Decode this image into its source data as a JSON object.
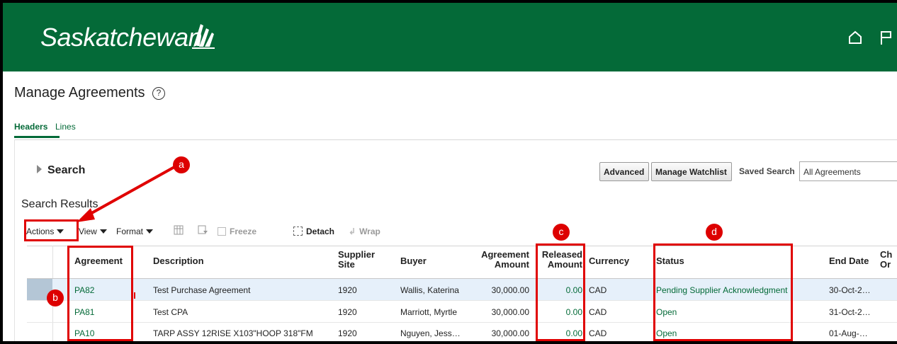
{
  "brand": {
    "name": "Saskatchewan"
  },
  "page": {
    "title": "Manage Agreements",
    "help_glyph": "?"
  },
  "tabs": [
    {
      "label": "Headers"
    },
    {
      "label": "Lines"
    }
  ],
  "search": {
    "toggle_label": "Search",
    "advanced_label": "Advanced",
    "watchlist_label": "Manage Watchlist",
    "saved_search_label": "Saved Search",
    "saved_search_value": "All Agreements"
  },
  "results": {
    "title": "Search Results",
    "toolbar": {
      "actions": "Actions",
      "view": "View",
      "format": "Format",
      "freeze": "Freeze",
      "detach": "Detach",
      "wrap": "Wrap"
    },
    "columns": {
      "agreement": "Agreement",
      "description": "Description",
      "supplier_site_1": "Supplier",
      "supplier_site_2": "Site",
      "buyer": "Buyer",
      "agreement_amount_1": "Agreement",
      "agreement_amount_2": "Amount",
      "released_amount_1": "Released",
      "released_amount_2": "Amount",
      "currency": "Currency",
      "status": "Status",
      "end_date": "End Date",
      "change_order_1": "Ch",
      "change_order_2": "Or"
    },
    "rows": [
      {
        "agreement": "PA82",
        "description": "Test Purchase Agreement",
        "site": "1920",
        "buyer": "Wallis, Katerina",
        "amount": "30,000.00",
        "released": "0.00",
        "currency": "CAD",
        "status": "Pending Supplier Acknowledgment",
        "end_date": "30-Oct-2…"
      },
      {
        "agreement": "PA81",
        "description": "Test CPA",
        "site": "1920",
        "buyer": "Marriott, Myrtle",
        "amount": "30,000.00",
        "released": "0.00",
        "currency": "CAD",
        "status": "Open",
        "end_date": "31-Oct-2…"
      },
      {
        "agreement": "PA10",
        "description": "TARP ASSY 12RISE X103\"HOOP 318\"FM",
        "site": "1920",
        "buyer": "Nguyen, Jess…",
        "amount": "30,000.00",
        "released": "0.00",
        "currency": "CAD",
        "status": "Open",
        "end_date": "01-Aug-…"
      }
    ]
  },
  "annotations": {
    "a": "a",
    "b": "b",
    "c": "c",
    "d": "d"
  },
  "colors": {
    "brand_green": "#046a38",
    "callout_red": "#dd0000",
    "selected_row": "#e6f0fa"
  },
  "icons": [
    "home-icon",
    "flag-icon",
    "help-icon",
    "freeze-icon",
    "detach-icon",
    "wrap-icon",
    "expand-triangle-icon"
  ]
}
